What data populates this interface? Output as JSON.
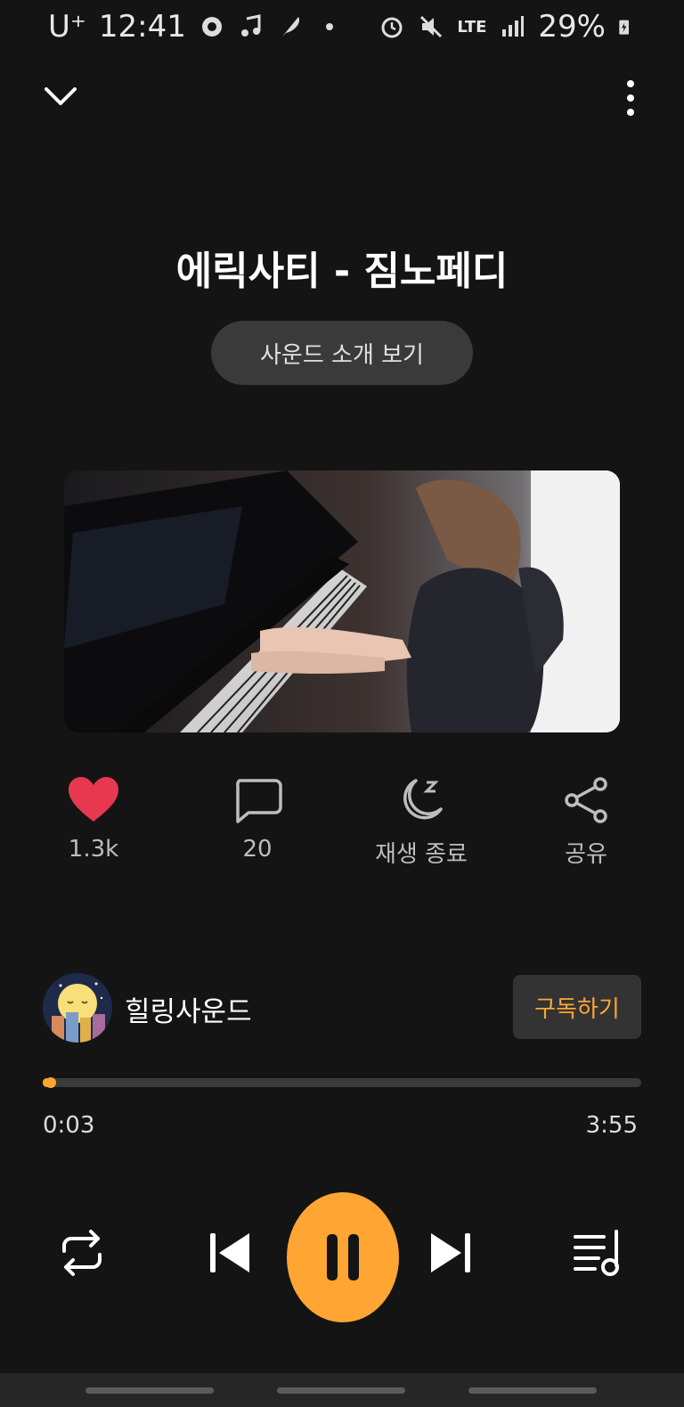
{
  "status_bar": {
    "carrier": "U⁺",
    "time": "12:41",
    "battery": "29%",
    "network": "LTE",
    "icons": [
      "settings-gear-icon",
      "music-note-icon",
      "feather-icon",
      "dot-icon",
      "alarm-icon",
      "mute-icon",
      "lte-icon",
      "signal-icon",
      "battery-charging-icon"
    ]
  },
  "player": {
    "title": "에릭사티 - 짐노페디",
    "about_label": "사운드 소개 보기",
    "actions": {
      "like_count": "1.3k",
      "comment_count": "20",
      "sleep_label": "재생 종료",
      "share_label": "공유"
    },
    "channel": {
      "name": "힐링사운드",
      "subscribe_label": "구독하기"
    },
    "progress": {
      "current": "0:03",
      "total": "3:55",
      "fraction": 0.013
    }
  },
  "colors": {
    "accent": "#ffa534",
    "like": "#e8384f",
    "background": "#141414"
  }
}
